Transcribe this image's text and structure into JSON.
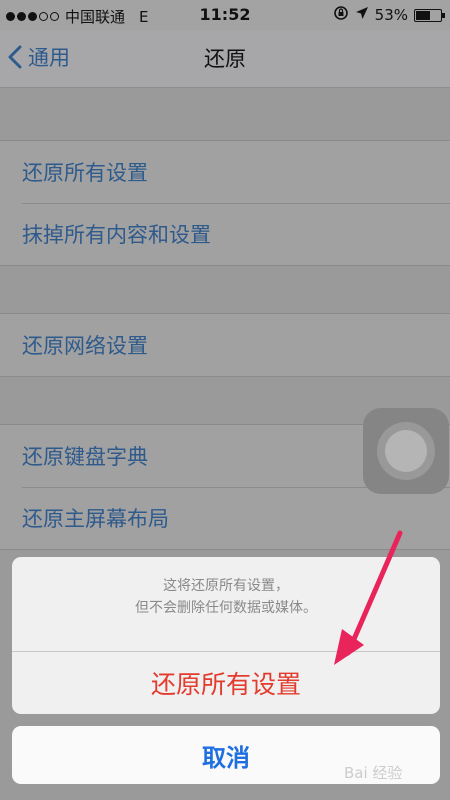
{
  "status_bar": {
    "carrier": "中国联通",
    "network": "E",
    "time": "11:52",
    "battery": "53%",
    "battery_level": 0.53
  },
  "nav": {
    "back_label": "通用",
    "title": "还原"
  },
  "groups": [
    {
      "items": [
        "还原所有设置",
        "抹掉所有内容和设置"
      ]
    },
    {
      "items": [
        "还原网络设置"
      ]
    },
    {
      "items": [
        "还原键盘字典",
        "还原主屏幕布局"
      ]
    }
  ],
  "action_sheet": {
    "message_line1": "这将还原所有设置，",
    "message_line2": "但不会删除任何数据或媒体。",
    "destructive_label": "还原所有设置",
    "cancel_label": "取消"
  },
  "colors": {
    "destructive": "#e33b2e",
    "tint": "#1f6fe0",
    "annotation_arrow": "#e8245a"
  },
  "watermark": "Bai 经验"
}
